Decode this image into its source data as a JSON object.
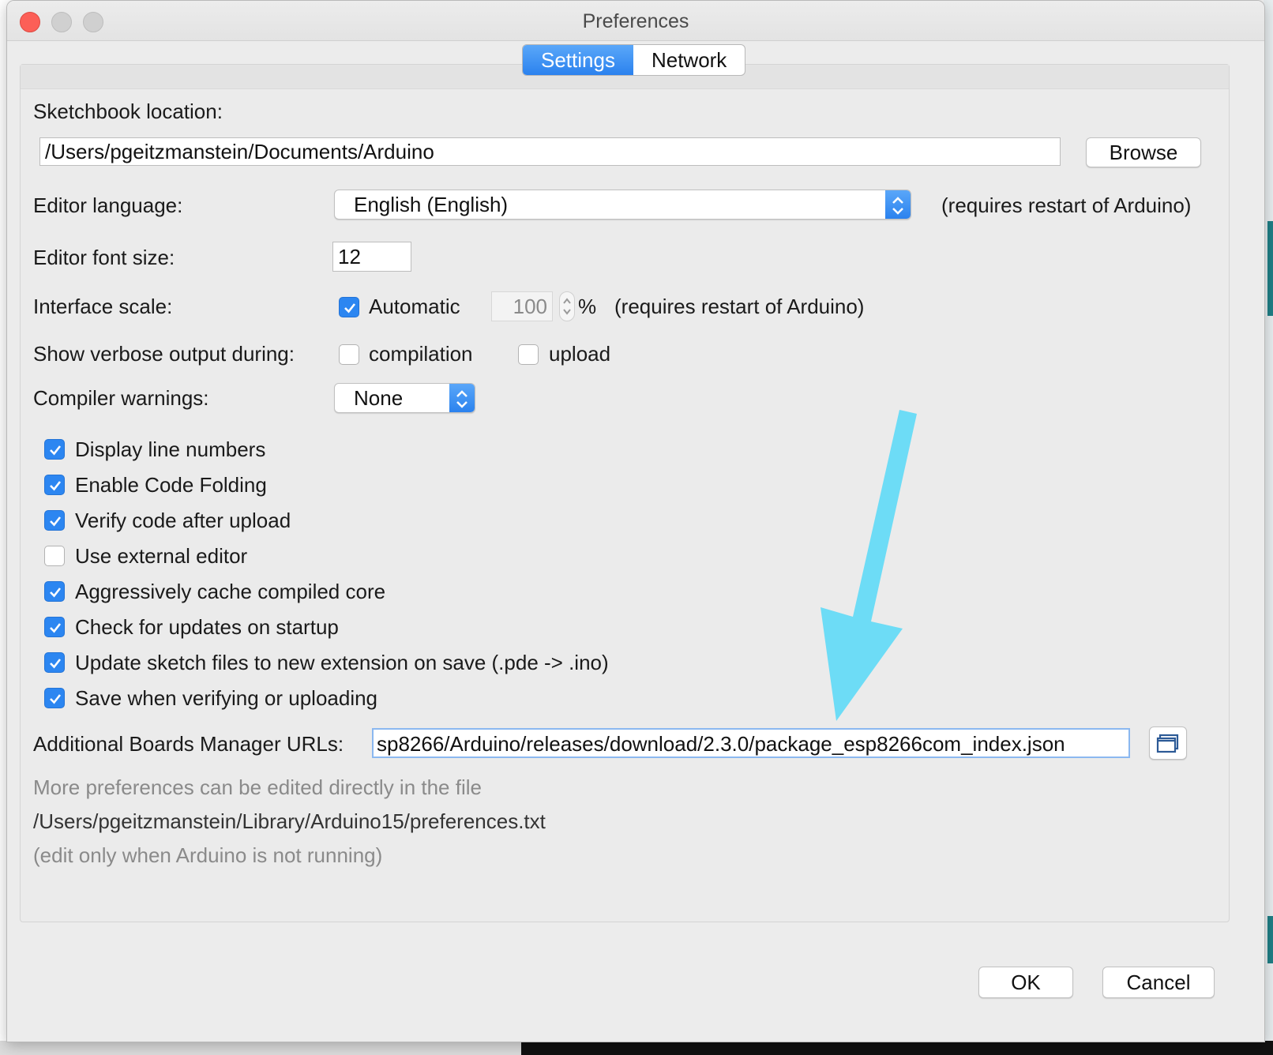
{
  "window": {
    "title": "Preferences",
    "tabs": [
      {
        "label": "Settings",
        "active": true
      },
      {
        "label": "Network",
        "active": false
      }
    ]
  },
  "sketchbook": {
    "label": "Sketchbook location:",
    "path": "/Users/pgeitzmanstein/Documents/Arduino",
    "browse_label": "Browse"
  },
  "editor_language": {
    "label": "Editor language:",
    "value": "English (English)",
    "note": "(requires restart of Arduino)"
  },
  "editor_font_size": {
    "label": "Editor font size:",
    "value": "12"
  },
  "interface_scale": {
    "label": "Interface scale:",
    "automatic_label": "Automatic",
    "automatic_checked": true,
    "value": "100",
    "unit": "%",
    "note": "(requires restart of Arduino)"
  },
  "verbose": {
    "label": "Show verbose output during:",
    "compilation_label": "compilation",
    "compilation_checked": false,
    "upload_label": "upload",
    "upload_checked": false
  },
  "compiler_warnings": {
    "label": "Compiler warnings:",
    "value": "None"
  },
  "options": [
    {
      "label": "Display line numbers",
      "checked": true
    },
    {
      "label": "Enable Code Folding",
      "checked": true
    },
    {
      "label": "Verify code after upload",
      "checked": true
    },
    {
      "label": "Use external editor",
      "checked": false
    },
    {
      "label": "Aggressively cache compiled core",
      "checked": true
    },
    {
      "label": "Check for updates on startup",
      "checked": true
    },
    {
      "label": "Update sketch files to new extension on save (.pde -> .ino)",
      "checked": true
    },
    {
      "label": "Save when verifying or uploading",
      "checked": true
    }
  ],
  "boards_manager": {
    "label": "Additional Boards Manager URLs:",
    "value": "sp8266/Arduino/releases/download/2.3.0/package_esp8266com_index.json",
    "edit_icon": "window-list-icon"
  },
  "footer_notes": {
    "line1": "More preferences can be edited directly in the file",
    "line2": "/Users/pgeitzmanstein/Library/Arduino15/preferences.txt",
    "line3": "(edit only when Arduino is not running)"
  },
  "buttons": {
    "ok_label": "OK",
    "cancel_label": "Cancel"
  },
  "colors": {
    "accent": "#2c86f1",
    "annotation_arrow": "#6ddcf6"
  }
}
